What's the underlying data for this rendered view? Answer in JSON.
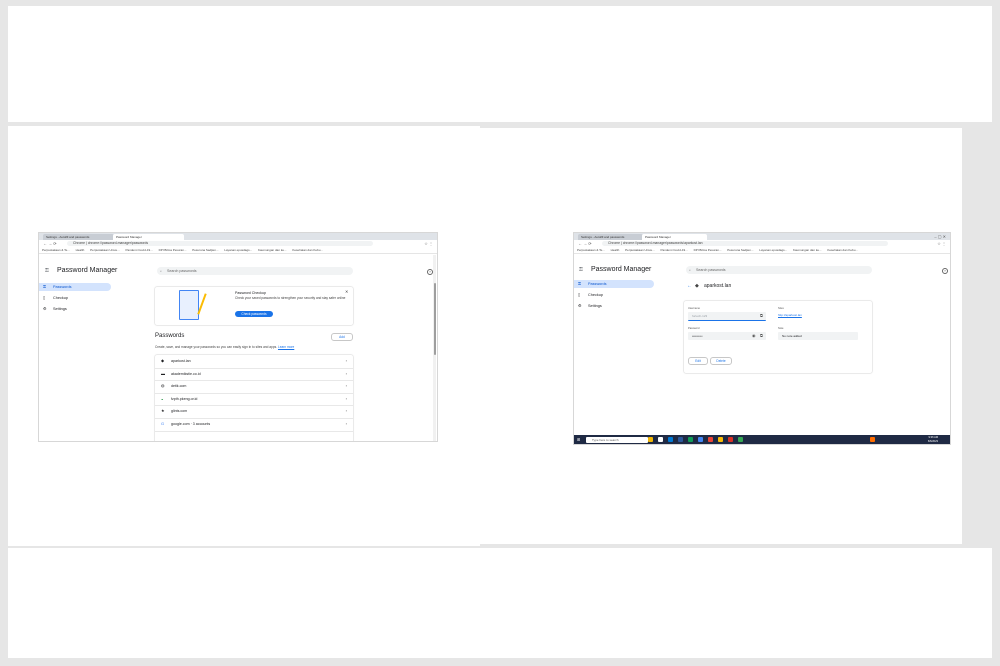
{
  "left": {
    "tabs": [
      {
        "label": "Settings - Autofill and passwords"
      },
      {
        "label": "Password Manager"
      }
    ],
    "url": "Chrome | chrome://password-manager/passwords",
    "bookmarks": [
      "Perpustakaan & Te...",
      "Health",
      "Perpustakaan Unive...",
      "Pandemi Covid-19...",
      "DPI Bilma Pesuran...",
      "Pesuruna Sadjien...",
      "Layanan epusdags...",
      "Kaumungan dan ke...",
      "Kesehatan dan Kebu..."
    ],
    "app_title": "Password Manager",
    "search_placeholder": "Search passwords",
    "nav": [
      {
        "label": "Passwords",
        "icon": "key-icon"
      },
      {
        "label": "Checkup",
        "icon": "clipboard-icon"
      },
      {
        "label": "Settings",
        "icon": "gear-icon"
      }
    ],
    "checkup_card": {
      "title": "Password Checkup",
      "body": "Check your saved passwords to strengthen your security and stay safer online",
      "button": "Check passwords"
    },
    "section_title": "Passwords",
    "add_label": "Add",
    "description": "Create, save, and manage your passwords so you can easily sign in to sites and apps.",
    "learn_more": "Learn more",
    "entries": [
      {
        "site": "aparkost.lan",
        "icon": "site-icon"
      },
      {
        "site": "akademikstie.co.id",
        "icon": "site-icon"
      },
      {
        "site": "detik.com",
        "icon": "globe-icon"
      },
      {
        "site": "fzpth.pkeng.or.id",
        "icon": "site-icon"
      },
      {
        "site": "glints.com",
        "icon": "site-icon"
      },
      {
        "site": "google.com · 3 accounts",
        "icon": "google-icon"
      }
    ]
  },
  "right": {
    "tabs": [
      {
        "label": "Settings - Autofill and passwords"
      },
      {
        "label": "Password Manager"
      }
    ],
    "url": "Chrome | chrome://password-manager/passwords/aparkost.lan",
    "bookmarks": [
      "Perpustakaan & Te...",
      "Health",
      "Perpustakaan Unive...",
      "Pandemi Covid-19...",
      "DPI Bilma Pesuran...",
      "Pesuruna Sadjien...",
      "Layanan epusdags...",
      "Kaumungan dan ke...",
      "Kesehatan dan Kebu..."
    ],
    "app_title": "Password Manager",
    "search_placeholder": "Search passwords",
    "nav": [
      {
        "label": "Passwords",
        "icon": "key-icon"
      },
      {
        "label": "Checkup",
        "icon": "clipboard-icon"
      },
      {
        "label": "Settings",
        "icon": "gear-icon"
      }
    ],
    "detail_title": "aparkost.lan",
    "username_label": "Username",
    "username_value": "fortech-123",
    "site_label": "Sites",
    "site_value": "http://aparkost.lan",
    "password_label": "Password",
    "password_value": "••••••••••",
    "note_label": "Note",
    "note_value": "No note added",
    "edit_label": "Edit",
    "delete_label": "Delete",
    "taskbar_search": "Type here to search",
    "time": "9:36 AM",
    "date": "6/6/2023"
  }
}
